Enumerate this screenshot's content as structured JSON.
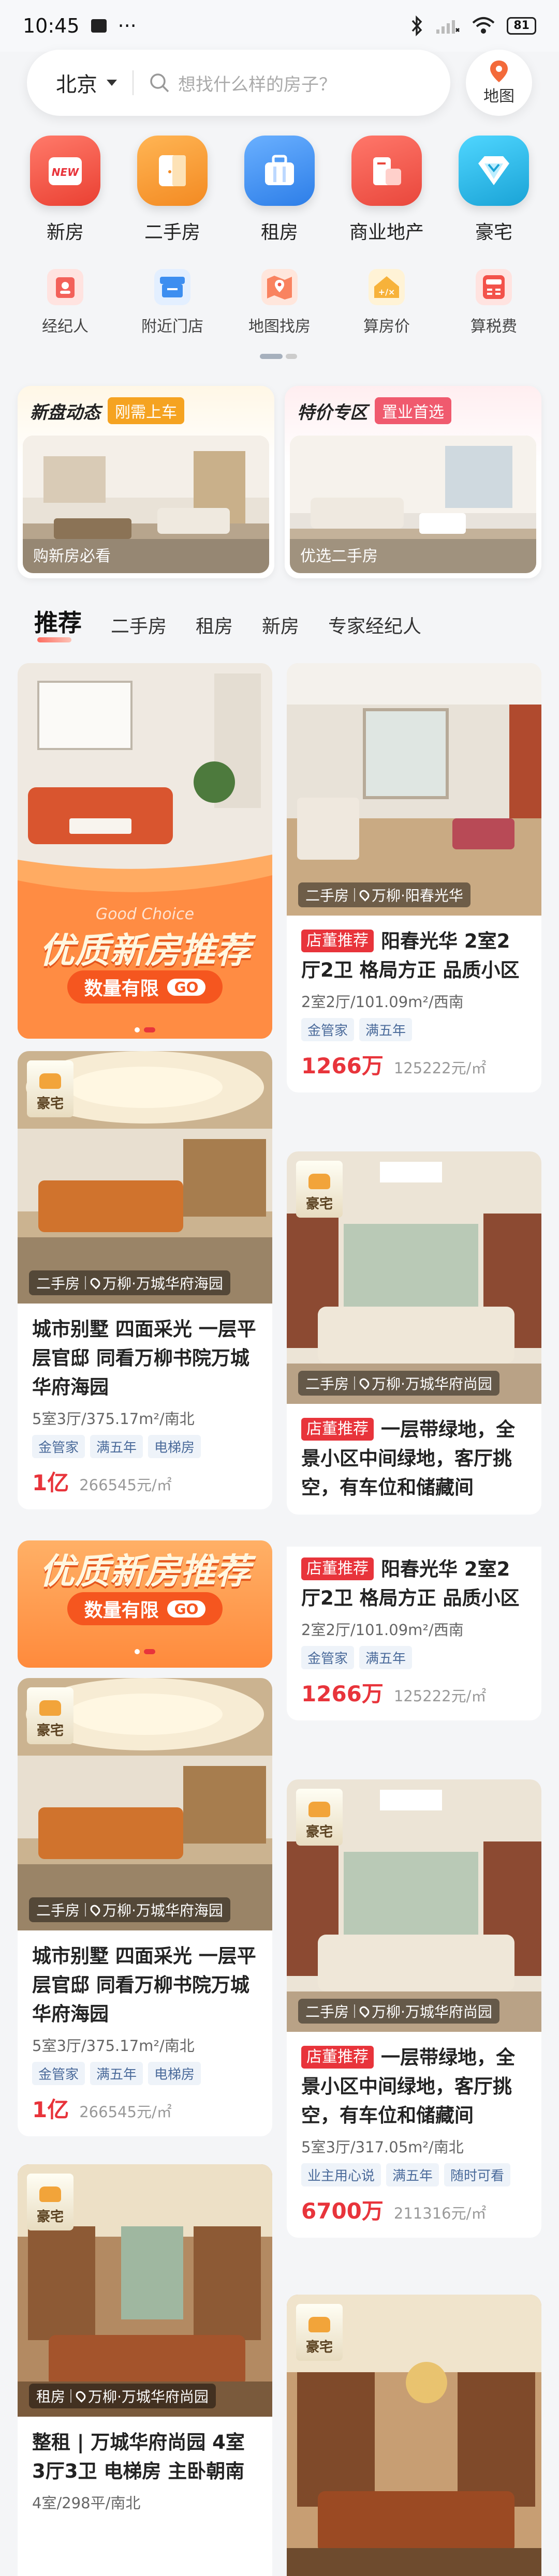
{
  "status": {
    "time": "10:45",
    "battery": "81"
  },
  "search": {
    "city": "北京",
    "placeholder": "想找什么样的房子？",
    "map_label": "地图"
  },
  "main_nav": [
    {
      "label": "新房",
      "badge": "NEW",
      "color": "#f05a4a"
    },
    {
      "label": "二手房",
      "color": "#f59a3b"
    },
    {
      "label": "租房",
      "color": "#3d8ef0"
    },
    {
      "label": "商业地产",
      "color": "#f0564a"
    },
    {
      "label": "豪宅",
      "color": "#24b6e6"
    }
  ],
  "sub_nav": [
    {
      "label": "经纪人",
      "icon": "agent-icon"
    },
    {
      "label": "附近门店",
      "icon": "store-icon"
    },
    {
      "label": "地图找房",
      "icon": "map-search-icon"
    },
    {
      "label": "算房价",
      "icon": "price-calc-icon"
    },
    {
      "label": "算税费",
      "icon": "tax-calc-icon"
    }
  ],
  "promos": [
    {
      "title": "新盘动态",
      "tag": "刚需上车",
      "caption": "购新房必看",
      "tag_color": "#f5a321"
    },
    {
      "title": "特价专区",
      "tag": "置业首选",
      "caption": "优选二手房",
      "tag_color": "#f05a6e"
    }
  ],
  "tabs": [
    "推荐",
    "二手房",
    "租房",
    "新房",
    "专家经纪人"
  ],
  "banner": {
    "headline": "优质新房推荐",
    "sub": "数量有限",
    "go": "GO",
    "script_text": "Good Choice"
  },
  "cards": {
    "c1": {
      "type": "二手房",
      "loc": "万柳·阳春光华",
      "rec": "店董推荐",
      "title": "阳春光华 2室2厅2卫 格局方正 品质小区",
      "meta": "2室2厅/101.09m²/西南",
      "tags": [
        "金管家",
        "满五年"
      ],
      "price": "1266万",
      "unit": "125222元/㎡"
    },
    "c2": {
      "type": "二手房",
      "loc": "万柳·万城华府海园",
      "badge": "豪宅",
      "title": "城市别墅 四面采光 一层平层官邸 同看万柳书院万城华府海园",
      "meta": "5室3厅/375.17m²/南北",
      "tags": [
        "金管家",
        "满五年",
        "电梯房"
      ],
      "price": "1亿",
      "unit": "266545元/㎡"
    },
    "c3": {
      "type": "二手房",
      "loc": "万柳·万城华府尚园",
      "badge": "豪宅",
      "rec": "店董推荐",
      "title": "一层带绿地，全景小区中间绿地，客厅挑空，有车位和储藏间"
    },
    "c4": {
      "rec": "店董推荐",
      "title": "阳春光华 2室2厅2卫 格局方正 品质小区",
      "meta": "2室2厅/101.09m²/西南",
      "tags": [
        "金管家",
        "满五年"
      ],
      "price": "1266万",
      "unit": "125222元/㎡"
    },
    "c5": {
      "type": "二手房",
      "loc": "万柳·万城华府海园",
      "badge": "豪宅",
      "title": "城市别墅 四面采光 一层平层官邸 同看万柳书院万城华府海园",
      "meta": "5室3厅/375.17m²/南北",
      "tags": [
        "金管家",
        "满五年",
        "电梯房"
      ],
      "price": "1亿",
      "unit": "266545元/㎡"
    },
    "c6": {
      "type": "二手房",
      "loc": "万柳·万城华府尚园",
      "badge": "豪宅",
      "rec": "店董推荐",
      "title": "一层带绿地，全景小区中间绿地，客厅挑空，有车位和储藏间",
      "meta": "5室3厅/317.05m²/南北",
      "tags": [
        "业主用心说",
        "满五年",
        "随时可看"
      ],
      "price": "6700万",
      "unit": "211316元/㎡"
    },
    "c7": {
      "type": "租房",
      "loc": "万柳·万城华府尚园",
      "badge": "豪宅",
      "title": "整租 | 万城华府尚园 4室3厅3卫 电梯房 主卧朝南",
      "meta": "4室/298平/南北"
    },
    "c8": {
      "badge": "豪宅"
    }
  }
}
